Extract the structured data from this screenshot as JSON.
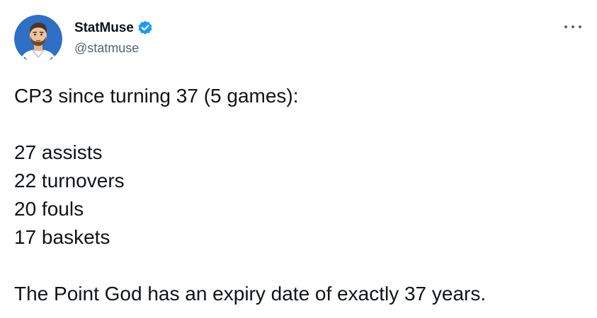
{
  "tweet": {
    "author": {
      "display_name": "StatMuse",
      "handle": "@statmuse",
      "verified": true,
      "avatar_icon": "cartoon-player-avatar",
      "verified_icon": "verified-badge-icon",
      "verified_color": "#1d9bf0"
    },
    "more_icon": "more-options-icon",
    "text": {
      "intro": "CP3 since turning 37 (5 games):",
      "stats": [
        "27 assists",
        "22 turnovers",
        "20 fouls",
        "17 baskets"
      ],
      "closing": "The Point God has an expiry date of exactly 37 years."
    }
  }
}
